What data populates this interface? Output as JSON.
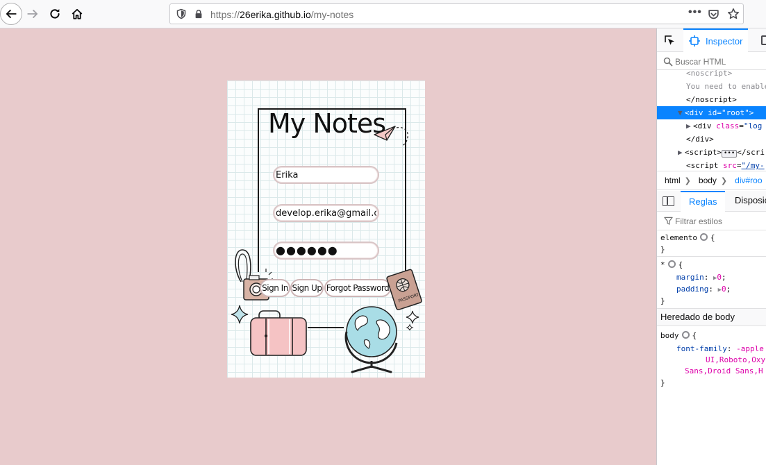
{
  "browser": {
    "url_prefix": "https://",
    "url_host": "26erika.github.io",
    "url_path": "/my-notes",
    "page_actions_glyph": "•••"
  },
  "page": {
    "title": "My Notes",
    "fields": {
      "name_value": "Erika",
      "email_value": "develop.erika@gmail.com",
      "password_mask": "●●●●●●"
    },
    "buttons": {
      "sign_in": "Sign In",
      "sign_up": "Sign Up",
      "forgot_password": "Forgot Password"
    },
    "passport_label": "PASSPORT",
    "colors": {
      "background": "#e8cbcc",
      "card": "#fbfdfd",
      "suitcase": "#f5c3c4",
      "globe": "#a9dde6",
      "camera": "#d8b3a5"
    }
  },
  "devtools": {
    "tab_inspector": "Inspector",
    "search_placeholder": "Buscar HTML",
    "markup": [
      {
        "indent": 3,
        "text": "<noscript>",
        "dim": true
      },
      {
        "indent": 3,
        "text": "You need to enable",
        "dim": true
      },
      {
        "indent": 3,
        "text": "</noscript>"
      },
      {
        "tag_open": "<div ",
        "attr": "id",
        "eq": "=",
        "val": "\"root\"",
        "tag_close": ">"
      },
      {
        "tag_open": "<div ",
        "attr": "class",
        "eq": "=",
        "val": "\"log"
      },
      {
        "text": "</div>"
      },
      {
        "tag_open": "<script>",
        "ellipsis": "•••",
        "tag_close": "</scri"
      },
      {
        "tag_open": "<script ",
        "attr": "src",
        "eq": "=",
        "val": "\"/my-"
      }
    ],
    "breadcrumbs": [
      "html",
      "body",
      "div#roo"
    ],
    "rules_tabs": {
      "rules": "Reglas",
      "layout": "Disposic"
    },
    "filter_placeholder": "Filtrar estilos",
    "rules": {
      "element_selector": "elemento",
      "universal_selector": "*",
      "margin_prop": "margin",
      "margin_val": "0",
      "padding_prop": "padding",
      "padding_val": "0",
      "inherited_header": "Heredado de body",
      "body_selector": "body",
      "font_prop": "font-family",
      "font_val_1": "-apple",
      "font_val_2": "UI,Roboto,Oxy",
      "font_val_3": "Sans,Droid Sans,H"
    }
  }
}
